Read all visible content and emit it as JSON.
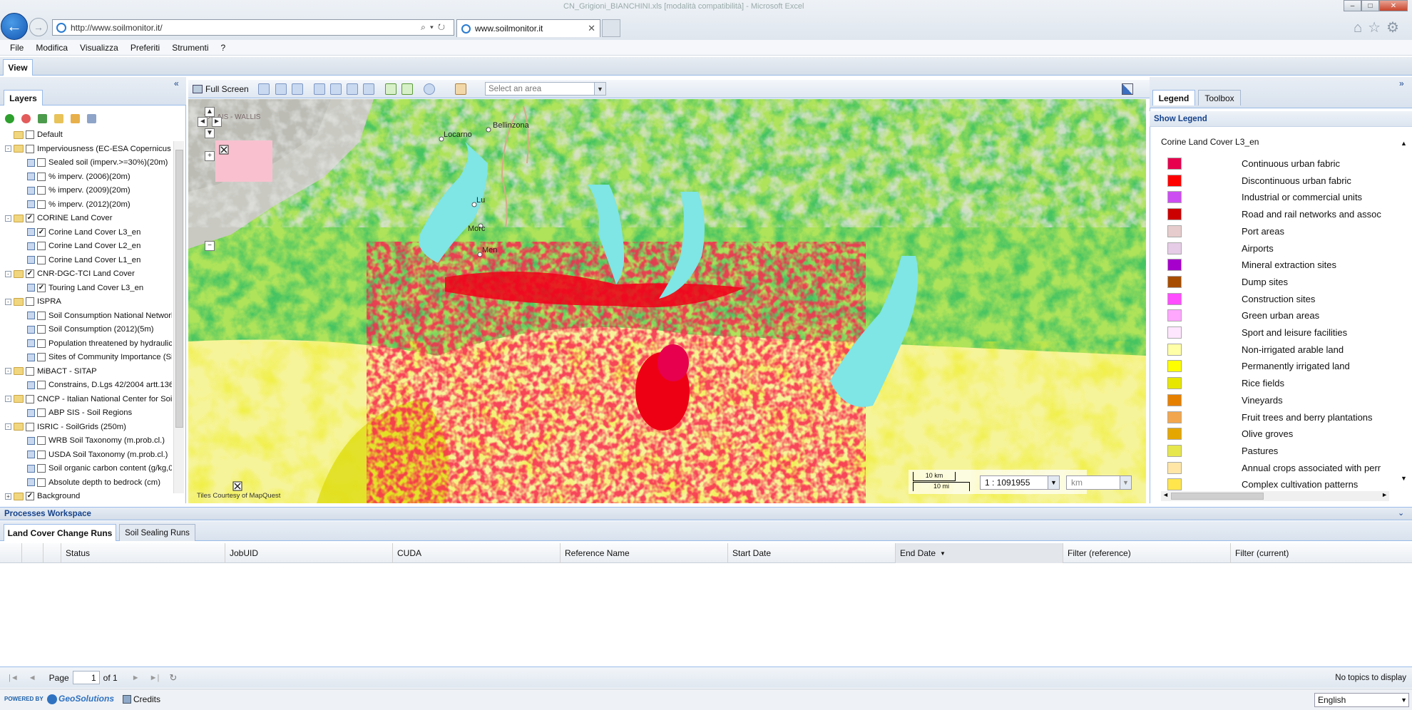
{
  "browser": {
    "window_title": "CN_Grigioni_BIANCHINI.xls [modalità compatibilità] - Microsoft Excel",
    "url": "http://www.soilmonitor.it/",
    "tab_title": "www.soilmonitor.it",
    "menu": [
      "File",
      "Modifica",
      "Visualizza",
      "Preferiti",
      "Strumenti",
      "?"
    ]
  },
  "app": {
    "view_tab": "View",
    "layers_tab": "Layers",
    "layers": [
      {
        "type": "group",
        "label": "Default",
        "level": 0,
        "checked": false,
        "pm": ""
      },
      {
        "type": "group",
        "label": "Imperviousness (EC-ESA Copernicus",
        "level": 0,
        "checked": false,
        "pm": "-"
      },
      {
        "type": "layer",
        "label": "Sealed soil (imperv.>=30%)(20m)",
        "level": 1,
        "checked": false
      },
      {
        "type": "layer",
        "label": "% imperv. (2006)(20m)",
        "level": 1,
        "checked": false
      },
      {
        "type": "layer",
        "label": "% imperv. (2009)(20m)",
        "level": 1,
        "checked": false
      },
      {
        "type": "layer",
        "label": "% imperv. (2012)(20m)",
        "level": 1,
        "checked": false
      },
      {
        "type": "group",
        "label": "CORINE Land Cover",
        "level": 0,
        "checked": true,
        "pm": "-"
      },
      {
        "type": "layer",
        "label": "Corine Land Cover L3_en",
        "level": 1,
        "checked": true
      },
      {
        "type": "layer",
        "label": "Corine Land Cover L2_en",
        "level": 1,
        "checked": false
      },
      {
        "type": "layer",
        "label": "Corine Land Cover L1_en",
        "level": 1,
        "checked": false
      },
      {
        "type": "group",
        "label": "CNR-DGC-TCI Land Cover",
        "level": 0,
        "checked": true,
        "pm": "-"
      },
      {
        "type": "layer",
        "label": "Touring Land Cover L3_en",
        "level": 1,
        "checked": true
      },
      {
        "type": "group",
        "label": "ISPRA",
        "level": 0,
        "checked": false,
        "pm": "-"
      },
      {
        "type": "layer",
        "label": "Soil Consumption National Networl",
        "level": 1,
        "checked": false
      },
      {
        "type": "layer",
        "label": "Soil Consumption (2012)(5m)",
        "level": 1,
        "checked": false
      },
      {
        "type": "layer",
        "label": "Population threatened by hydraulic",
        "level": 1,
        "checked": false
      },
      {
        "type": "layer",
        "label": "Sites of Community Importance (Si",
        "level": 1,
        "checked": false
      },
      {
        "type": "group",
        "label": "MiBACT - SITAP",
        "level": 0,
        "checked": false,
        "pm": "-"
      },
      {
        "type": "layer",
        "label": "Constrains, D.Lgs 42/2004 artt.136",
        "level": 1,
        "checked": false
      },
      {
        "type": "group",
        "label": "CNCP - Italian National Center for Soi",
        "level": 0,
        "checked": false,
        "pm": "-"
      },
      {
        "type": "layer",
        "label": "ABP SIS - Soil Regions",
        "level": 1,
        "checked": false
      },
      {
        "type": "group",
        "label": "ISRIC - SoilGrids (250m)",
        "level": 0,
        "checked": false,
        "pm": "-"
      },
      {
        "type": "layer",
        "label": "WRB Soil Taxonomy (m.prob.cl.)",
        "level": 1,
        "checked": false
      },
      {
        "type": "layer",
        "label": "USDA Soil Taxonomy (m.prob.cl.)",
        "level": 1,
        "checked": false
      },
      {
        "type": "layer",
        "label": "Soil organic carbon content (g/kg,0",
        "level": 1,
        "checked": false
      },
      {
        "type": "layer",
        "label": "Absolute depth to bedrock (cm)",
        "level": 1,
        "checked": false
      },
      {
        "type": "group",
        "label": "Background",
        "level": 0,
        "checked": true,
        "pm": "+"
      }
    ],
    "map": {
      "full_screen": "Full Screen",
      "area_placeholder": "Select an area",
      "attribution": "Tiles Courtesy of MapQuest",
      "scale_km": "10 km",
      "scale_mi": "10 mi",
      "scale_value": "1 : 1091955",
      "unit": "km",
      "places": [
        "VALAIS - WALLIS",
        "Locarno",
        "Bellinzona",
        "Lu",
        "Morc",
        "Men"
      ]
    },
    "right_tabs": {
      "legend": "Legend",
      "toolbox": "Toolbox"
    },
    "show_legend": "Show Legend",
    "legend_title": "Corine Land Cover L3_en",
    "legend": [
      {
        "label": "Continuous urban fabric",
        "color": "#e6004d"
      },
      {
        "label": "Discontinuous urban fabric",
        "color": "#ff0000"
      },
      {
        "label": "Industrial or commercial units",
        "color": "#cc4df2"
      },
      {
        "label": "Road and rail networks and assoc",
        "color": "#cc0000"
      },
      {
        "label": "Port areas",
        "color": "#e6cccc"
      },
      {
        "label": "Airports",
        "color": "#e6cce6"
      },
      {
        "label": "Mineral extraction sites",
        "color": "#a600cc"
      },
      {
        "label": "Dump sites",
        "color": "#a64d00"
      },
      {
        "label": "Construction sites",
        "color": "#ff4dff"
      },
      {
        "label": "Green urban areas",
        "color": "#ffa6ff"
      },
      {
        "label": "Sport and leisure facilities",
        "color": "#ffe6ff"
      },
      {
        "label": "Non-irrigated arable land",
        "color": "#ffffa8"
      },
      {
        "label": "Permanently irrigated land",
        "color": "#ffff00"
      },
      {
        "label": "Rice fields",
        "color": "#e6e600"
      },
      {
        "label": "Vineyards",
        "color": "#e68000"
      },
      {
        "label": "Fruit trees and berry plantations",
        "color": "#f2a64d"
      },
      {
        "label": "Olive groves",
        "color": "#e6a600"
      },
      {
        "label": "Pastures",
        "color": "#e6e64d"
      },
      {
        "label": "Annual crops associated with perr",
        "color": "#ffe6a6"
      },
      {
        "label": "Complex cultivation patterns",
        "color": "#ffe64d"
      }
    ],
    "processes": {
      "title": "Processes Workspace",
      "tabs": [
        "Land Cover Change Runs",
        "Soil Sealing Runs"
      ],
      "columns": [
        "Status",
        "JobUID",
        "CUDA",
        "Reference Name",
        "Start Date",
        "End Date",
        "Filter (reference)",
        "Filter (current)"
      ],
      "page_label": "Page",
      "page_value": "1",
      "of_label": "of 1",
      "empty_message": "No topics to display"
    },
    "footer": {
      "powered_by": "POWERED BY",
      "brand": "GeoSolutions",
      "credits": "Credits",
      "language": "English"
    }
  }
}
